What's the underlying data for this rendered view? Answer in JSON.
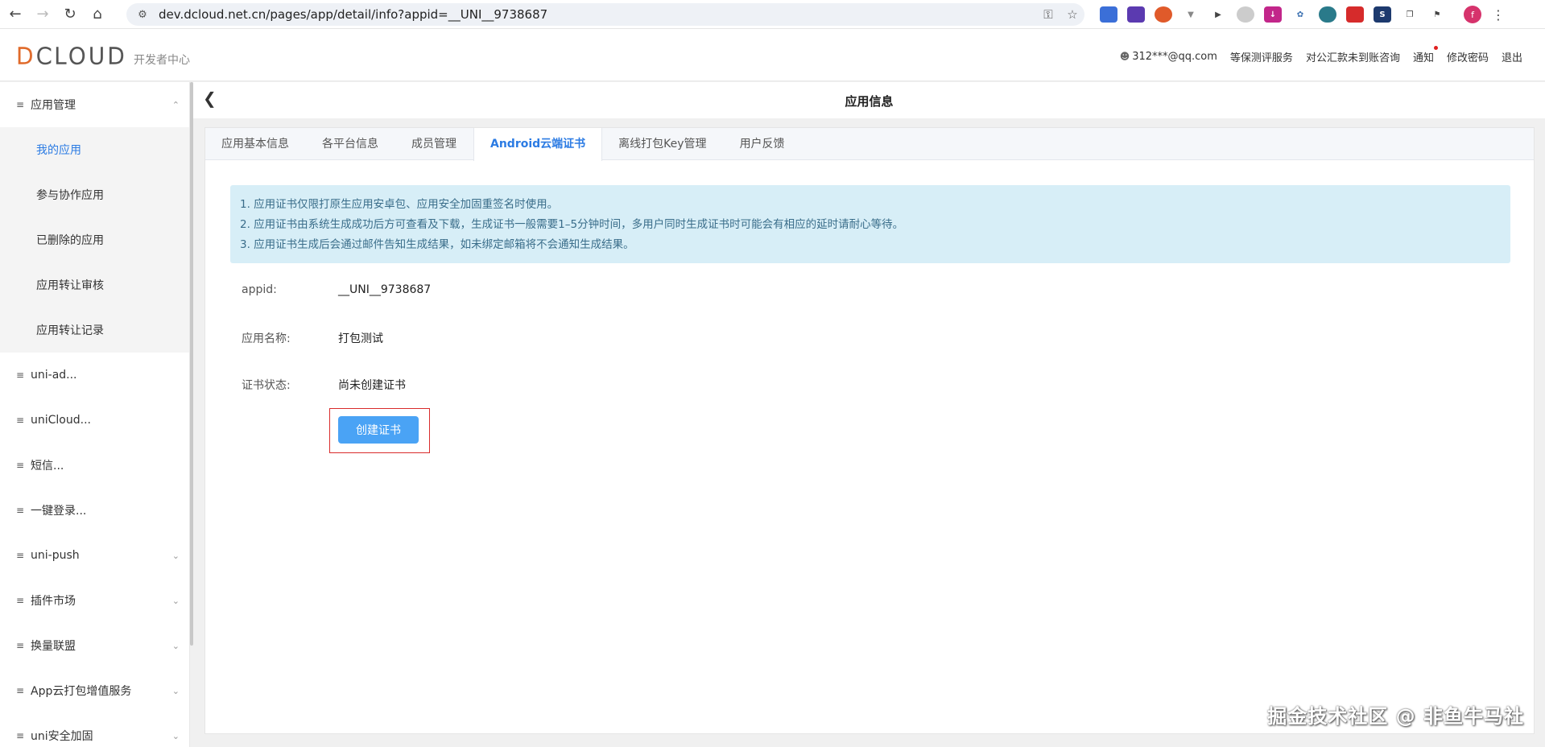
{
  "browser": {
    "url": "dev.dcloud.net.cn/pages/app/detail/info?appid=__UNI__9738687",
    "profile_initial": "f"
  },
  "header": {
    "logo_text": "DCLOUD",
    "logo_subtitle": "开发者中心",
    "user_email": "312***@qq.com",
    "links": [
      "等保测评服务",
      "对公汇款未到账咨询",
      "通知",
      "修改密码",
      "退出"
    ]
  },
  "sidebar": {
    "app_management": "应用管理",
    "sub_items": [
      "我的应用",
      "参与协作应用",
      "已删除的应用",
      "应用转让审核",
      "应用转让记录"
    ],
    "menus": [
      "uni-ad...",
      "uniCloud...",
      "短信...",
      "一键登录...",
      "uni-push",
      "插件市场",
      "换量联盟",
      "App云打包增值服务",
      "uni安全加固"
    ]
  },
  "main": {
    "page_title": "应用信息",
    "tabs": [
      "应用基本信息",
      "各平台信息",
      "成员管理",
      "Android云端证书",
      "离线打包Key管理",
      "用户反馈"
    ],
    "notices": [
      "1. 应用证书仅限打原生应用安卓包、应用安全加固重签名时使用。",
      "2. 应用证书由系统生成成功后方可查看及下载，生成证书一般需要1–5分钟时间，多用户同时生成证书时可能会有相应的延时请耐心等待。",
      "3. 应用证书生成后会通过邮件告知生成结果，如未绑定邮箱将不会通知生成结果。"
    ],
    "fields": {
      "appid_label": "appid:",
      "appid_value": "__UNI__9738687",
      "name_label": "应用名称:",
      "name_value": "打包测试",
      "status_label": "证书状态:",
      "status_value": "尚未创建证书"
    },
    "create_button": "创建证书"
  },
  "watermark": "掘金技术社区 @ 非鱼牛马社"
}
